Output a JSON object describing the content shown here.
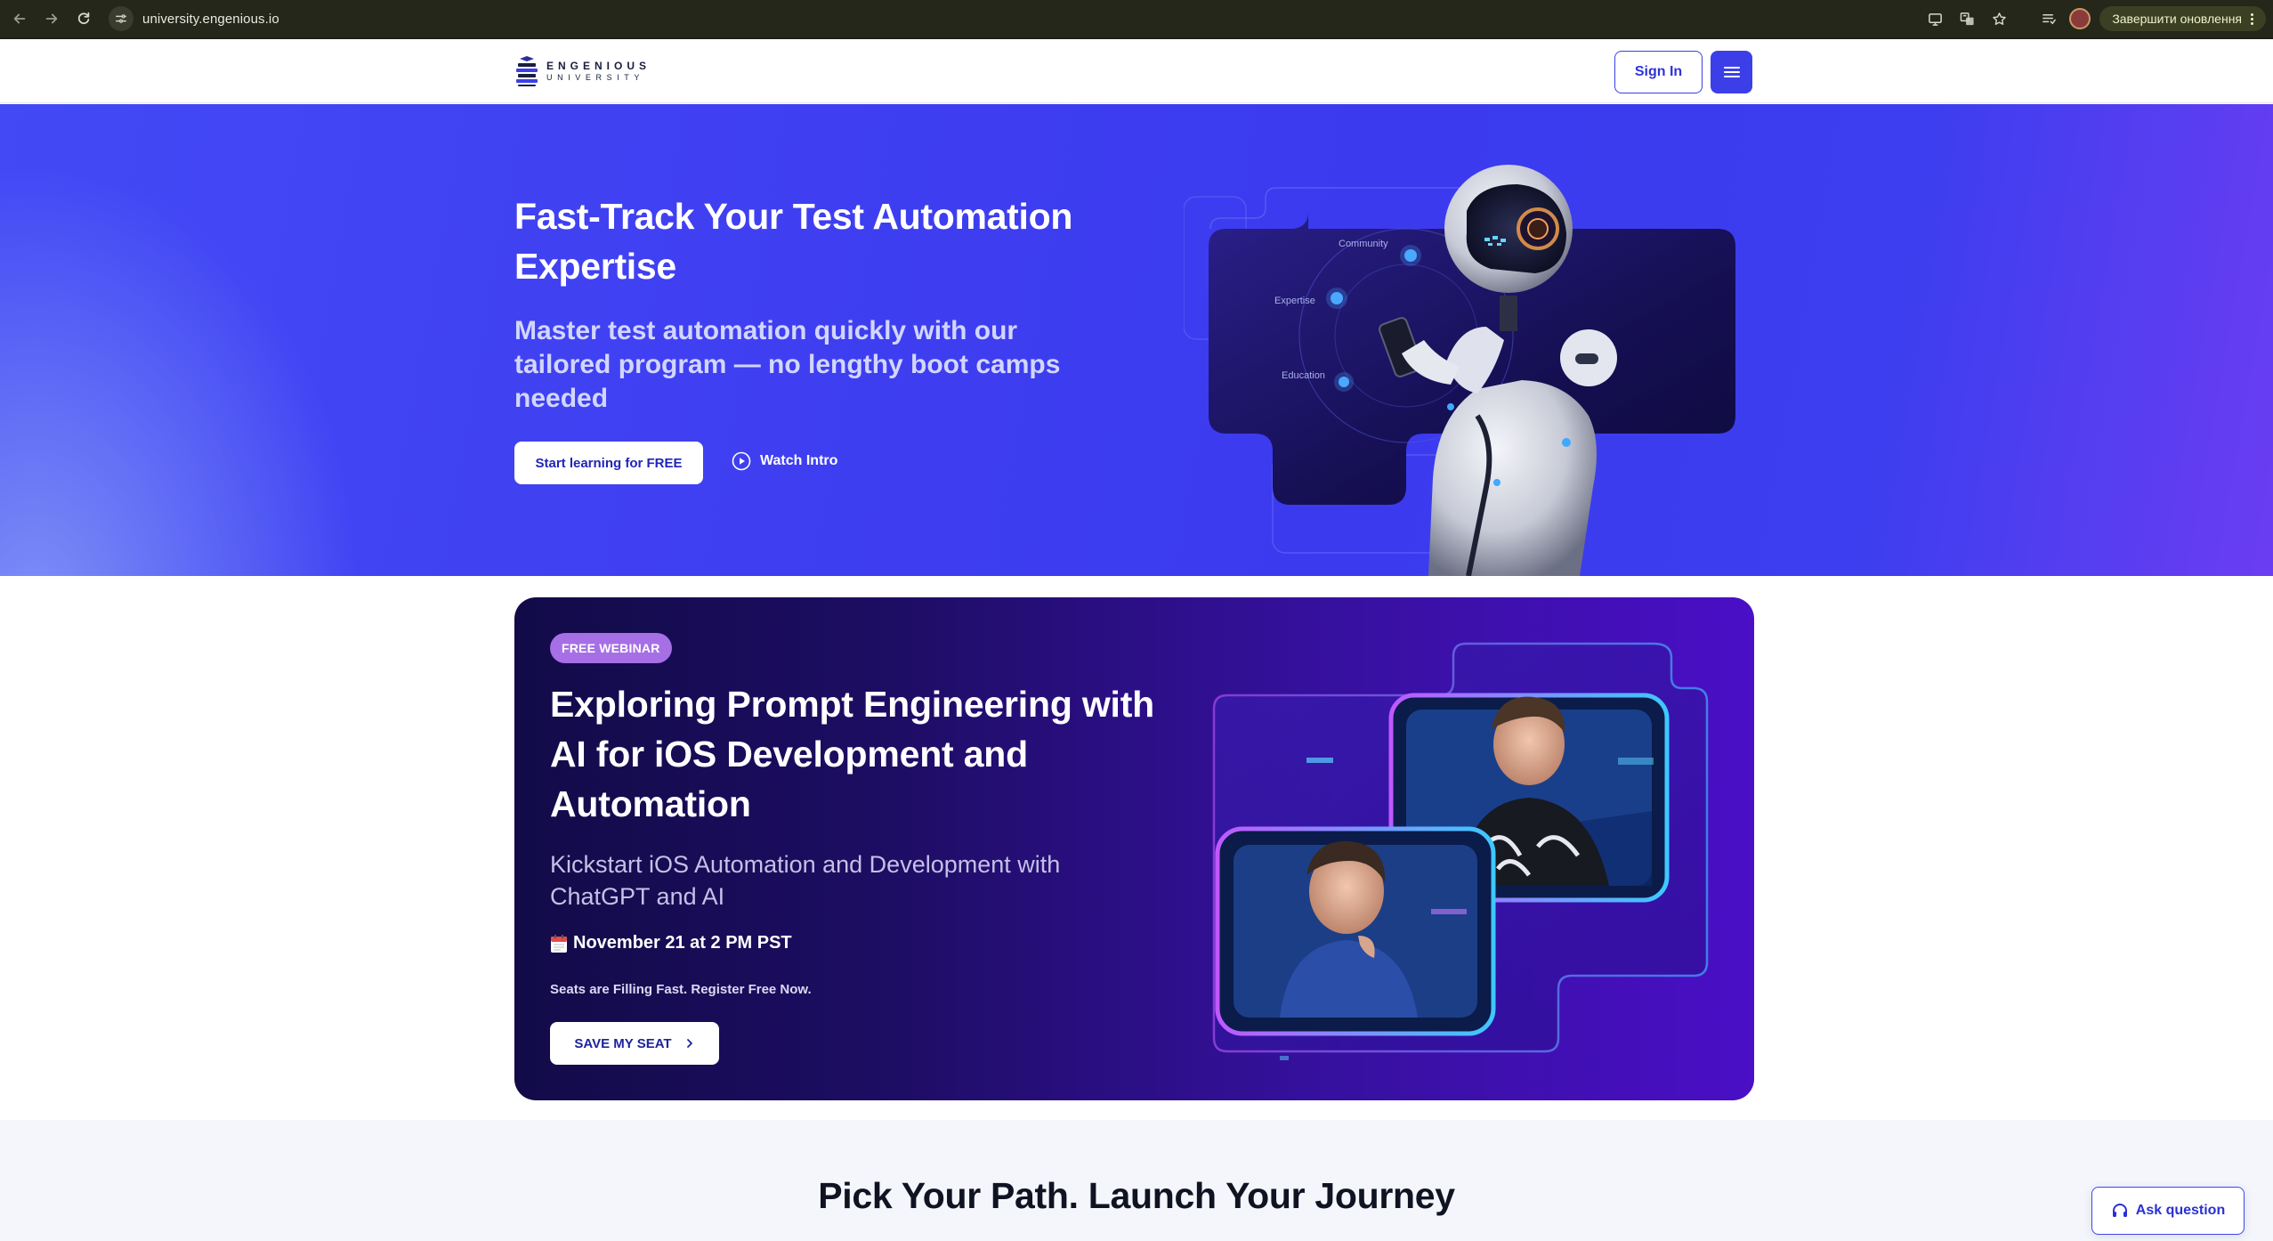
{
  "browser": {
    "url": "university.engenious.io",
    "update_label": "Завершити оновлення",
    "icons": [
      "back-arrow-icon",
      "forward-arrow-icon",
      "reload-icon",
      "site-info-icon",
      "cast-icon",
      "translate-icon",
      "bookmark-star-icon",
      "reading-list-icon",
      "profile-avatar",
      "more-icon"
    ]
  },
  "header": {
    "logo_line1": "ENGENIOUS",
    "logo_line2": "UNIVERSITY",
    "signin_label": "Sign In",
    "menu_icon": "hamburger-menu-icon"
  },
  "hero": {
    "title": "Fast-Track Your Test Automation Expertise",
    "subtitle": "Master test automation quickly with our tailored program — no lengthy boot camps needed",
    "cta_label": "Start learning for FREE",
    "watch_label": "Watch Intro",
    "art_labels": [
      "Community",
      "Expertise",
      "Education"
    ]
  },
  "webinar": {
    "badge": "FREE WEBINAR",
    "title": "Exploring Prompt Engineering with AI for iOS Development and Automation",
    "subtitle": "Kickstart iOS Automation and Development with ChatGPT and AI",
    "date": "November 21 at 2 PM PST",
    "note": "Seats are Filling Fast. Register Free Now.",
    "cta_label": "SAVE MY SEAT"
  },
  "path_section": {
    "title": "Pick Your Path. Launch Your Journey"
  },
  "chat": {
    "label": "Ask question"
  },
  "colors": {
    "brand_blue": "#3c3fe8",
    "webinar_badge": "#a66fe6",
    "chrome_bg": "#24271a"
  }
}
